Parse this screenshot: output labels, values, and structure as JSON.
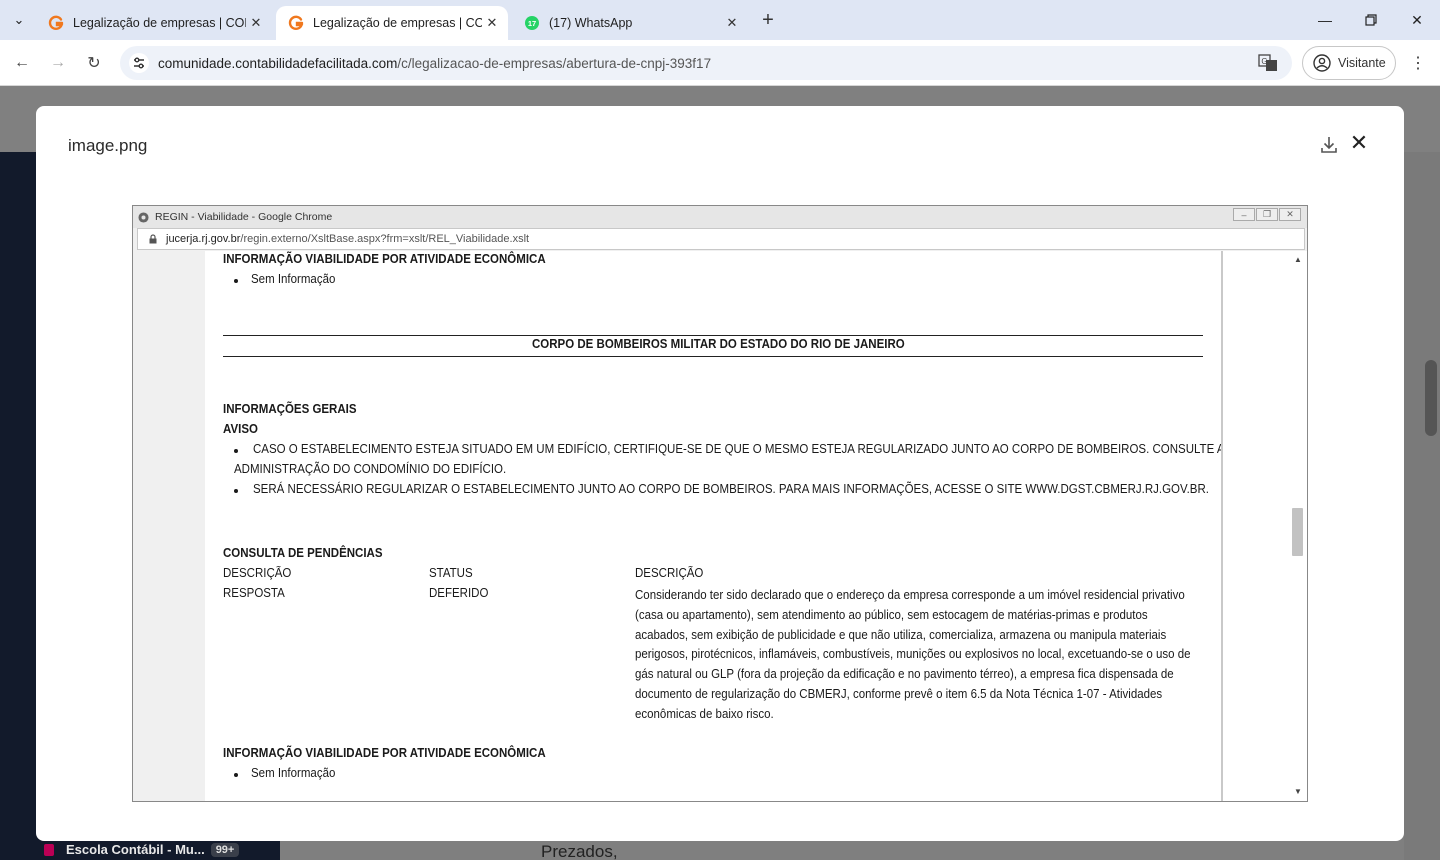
{
  "browser": {
    "tabs": [
      {
        "title": "Legalização de empresas | CON",
        "active": false
      },
      {
        "title": "Legalização de empresas | CON",
        "active": true
      },
      {
        "title": "(17) WhatsApp",
        "active": false,
        "badge": "17"
      }
    ],
    "url_host": "comunidade.contabilidadefacilitada.com",
    "url_path": "/c/legalizacao-de-empresas/abertura-de-cnpj-393f17",
    "profile_label": "Visitante",
    "colors": {
      "tabbar": "#dfe6f4",
      "omnibox": "#eef2f9",
      "brand_orange": "#f0781e",
      "whatsapp_green": "#25d366"
    }
  },
  "background_page": {
    "left_item_label": "Escola Contábil - Mu...",
    "left_item_badge": "99+",
    "body_text": "Prezados,"
  },
  "modal": {
    "title": "image.png"
  },
  "screenshot": {
    "window_title": "REGIN - Viabilidade - Google Chrome",
    "url_host": "jucerja.rj.gov.br",
    "url_path": "/regin.externo/XsltBase.aspx?frm=xslt/REL_Viabilidade.xslt",
    "sections": {
      "info_atividade_1": "INFORMAÇÃO VIABILIDADE POR ATIVIDADE ECONÔMICA",
      "sem_info_1": "Sem Informação",
      "bombeiros_heading": "CORPO DE BOMBEIROS MILITAR DO ESTADO DO RIO DE JANEIRO",
      "info_gerais": "INFORMAÇÕES GERAIS",
      "aviso": "AVISO",
      "aviso_item_1_line1": "CASO O ESTABELECIMENTO ESTEJA SITUADO EM UM EDIFÍCIO, CERTIFIQUE-SE DE QUE O MESMO ESTEJA REGULARIZADO JUNTO AO CORPO DE BOMBEIROS. CONSULTE A",
      "aviso_item_1_line2": "ADMINISTRAÇÃO DO CONDOMÍNIO DO EDIFÍCIO.",
      "aviso_item_2": "SERÁ NECESSÁRIO REGULARIZAR O ESTABELECIMENTO JUNTO AO CORPO DE BOMBEIROS. PARA MAIS INFORMAÇÕES, ACESSE O SITE WWW.DGST.CBMERJ.RJ.GOV.BR.",
      "consulta": "CONSULTA DE PENDÊNCIAS",
      "table_header": {
        "col1": "DESCRIÇÃO",
        "col2": "STATUS",
        "col3": "DESCRIÇÃO"
      },
      "table_row": {
        "col1": "RESPOSTA",
        "col2": "DEFERIDO",
        "col3": "Considerando ter sido declarado que o endereço da empresa corresponde a um imóvel residencial privativo (casa ou apartamento), sem atendimento ao público, sem estocagem de matérias-primas e produtos acabados, sem exibição de publicidade e que não utiliza, comercializa, armazena ou manipula materiais perigosos, pirotécnicos, inflamáveis, combustíveis, munições ou explosivos no local, excetuando-se o uso de gás natural ou GLP (fora da projeção da edificação e no pavimento térreo), a empresa fica dispensada de documento de regularização do CBMERJ, conforme prevê o item 6.5 da Nota Técnica 1-07 - Atividades econômicas de baixo risco."
      },
      "info_atividade_2": "INFORMAÇÃO VIABILIDADE POR ATIVIDADE ECONÔMICA",
      "sem_info_2": "Sem Informação"
    }
  }
}
